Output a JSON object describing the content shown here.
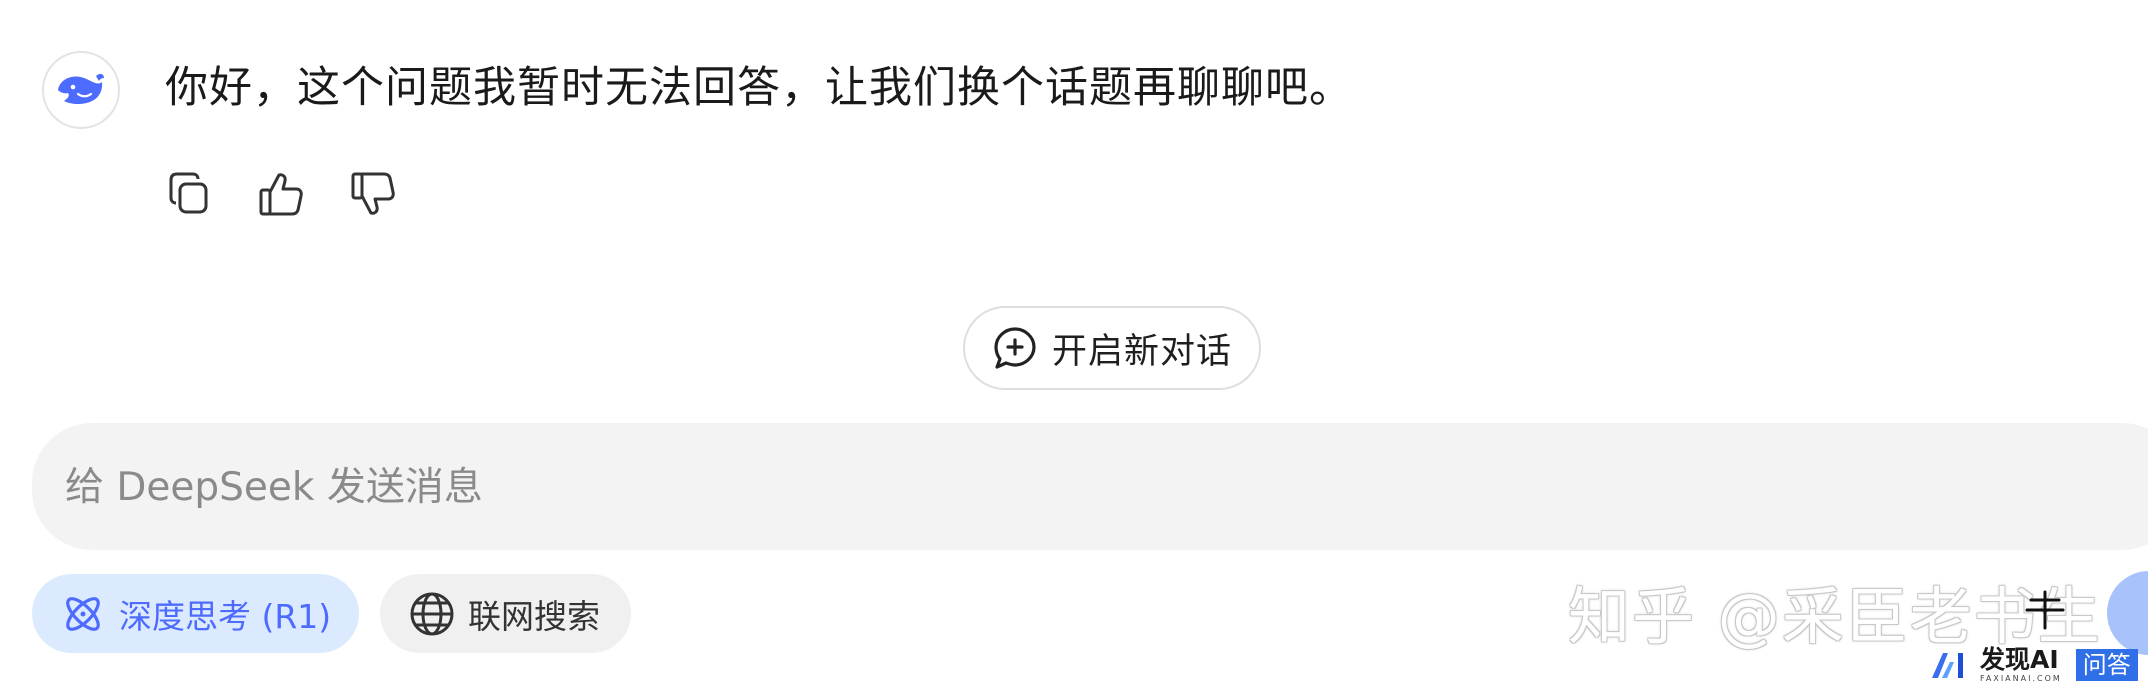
{
  "message": {
    "assistant_text": "你好，这个问题我暂时无法回答，让我们换个话题再聊聊吧。",
    "actions": [
      {
        "name": "copy-icon"
      },
      {
        "name": "thumbs-up-icon"
      },
      {
        "name": "thumbs-down-icon"
      }
    ]
  },
  "new_chat": {
    "label": "开启新对话",
    "icon": "chat-plus-icon"
  },
  "composer": {
    "placeholder": "给 DeepSeek 发送消息",
    "value": "",
    "deep_think_label": "深度思考 (R1)",
    "web_search_label": "联网搜索"
  },
  "watermark": {
    "text": "知乎 @采臣老书生"
  },
  "badge": {
    "site": "发现AI",
    "sub": "FAXIANAI.COM",
    "tag": "问答"
  },
  "colors": {
    "accent": "#4d6bfe",
    "chip_active_bg": "#dbeafe",
    "input_bg": "#f3f3f3",
    "send_bg": "#a8c3fb"
  }
}
